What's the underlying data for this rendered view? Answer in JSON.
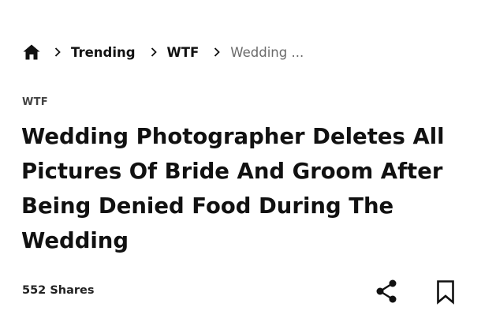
{
  "breadcrumb": {
    "home_icon": "home-icon",
    "separator_icon": "chevron-right-icon",
    "items": [
      {
        "label": "Trending"
      },
      {
        "label": "WTF"
      }
    ],
    "current": "Wedding ..."
  },
  "article": {
    "category": "WTF",
    "title": "Wedding Photographer Deletes All Pictures Of Bride And Groom After Being Denied Food During The Wedding",
    "shares": "552 Shares"
  },
  "actions": {
    "share_icon": "share-icon",
    "bookmark_icon": "bookmark-icon"
  },
  "colors": {
    "text": "#111111",
    "muted": "#6a6a6a",
    "background": "#ffffff"
  }
}
